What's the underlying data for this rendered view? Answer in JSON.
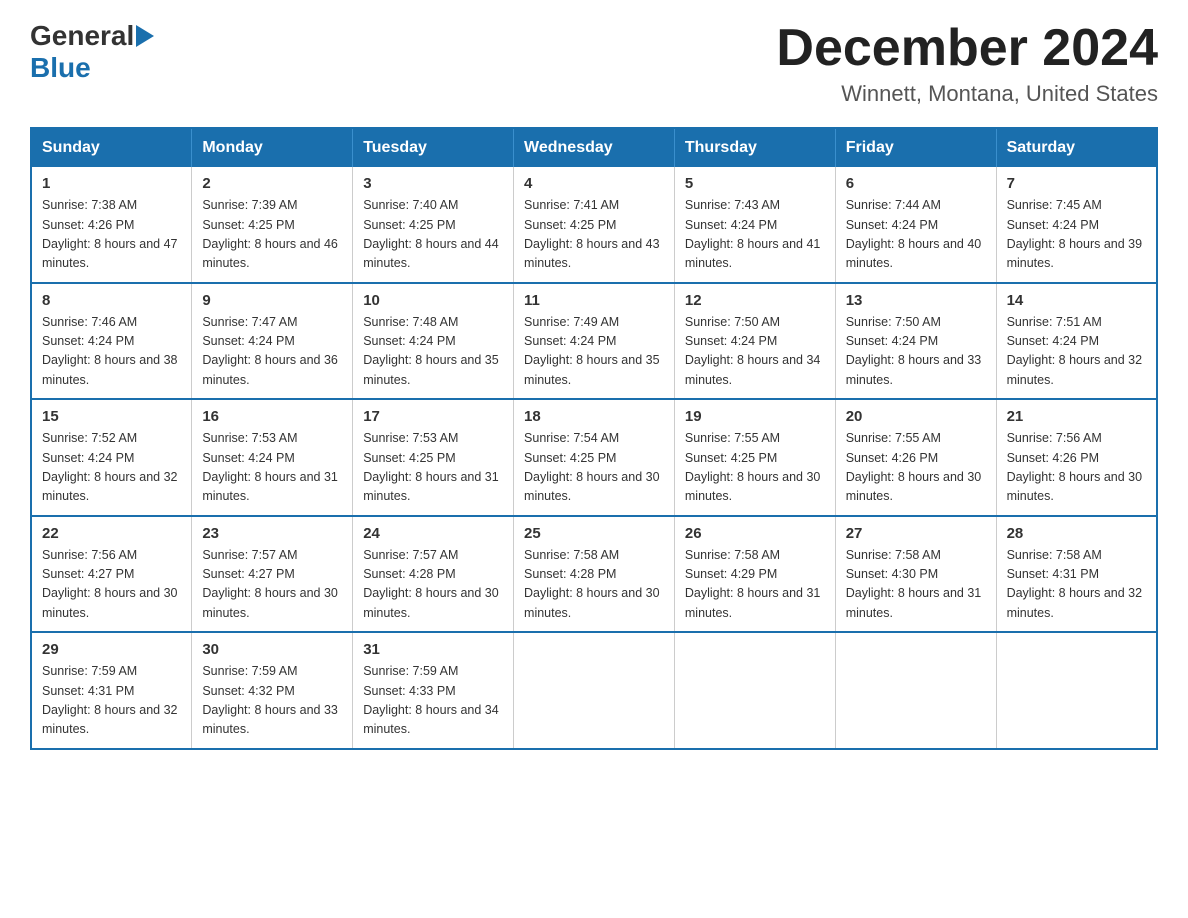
{
  "header": {
    "logo_general": "General",
    "logo_blue": "Blue",
    "title": "December 2024",
    "subtitle": "Winnett, Montana, United States"
  },
  "calendar": {
    "days_of_week": [
      "Sunday",
      "Monday",
      "Tuesday",
      "Wednesday",
      "Thursday",
      "Friday",
      "Saturday"
    ],
    "weeks": [
      [
        {
          "day": "1",
          "sunrise": "7:38 AM",
          "sunset": "4:26 PM",
          "daylight": "8 hours and 47 minutes."
        },
        {
          "day": "2",
          "sunrise": "7:39 AM",
          "sunset": "4:25 PM",
          "daylight": "8 hours and 46 minutes."
        },
        {
          "day": "3",
          "sunrise": "7:40 AM",
          "sunset": "4:25 PM",
          "daylight": "8 hours and 44 minutes."
        },
        {
          "day": "4",
          "sunrise": "7:41 AM",
          "sunset": "4:25 PM",
          "daylight": "8 hours and 43 minutes."
        },
        {
          "day": "5",
          "sunrise": "7:43 AM",
          "sunset": "4:24 PM",
          "daylight": "8 hours and 41 minutes."
        },
        {
          "day": "6",
          "sunrise": "7:44 AM",
          "sunset": "4:24 PM",
          "daylight": "8 hours and 40 minutes."
        },
        {
          "day": "7",
          "sunrise": "7:45 AM",
          "sunset": "4:24 PM",
          "daylight": "8 hours and 39 minutes."
        }
      ],
      [
        {
          "day": "8",
          "sunrise": "7:46 AM",
          "sunset": "4:24 PM",
          "daylight": "8 hours and 38 minutes."
        },
        {
          "day": "9",
          "sunrise": "7:47 AM",
          "sunset": "4:24 PM",
          "daylight": "8 hours and 36 minutes."
        },
        {
          "day": "10",
          "sunrise": "7:48 AM",
          "sunset": "4:24 PM",
          "daylight": "8 hours and 35 minutes."
        },
        {
          "day": "11",
          "sunrise": "7:49 AM",
          "sunset": "4:24 PM",
          "daylight": "8 hours and 35 minutes."
        },
        {
          "day": "12",
          "sunrise": "7:50 AM",
          "sunset": "4:24 PM",
          "daylight": "8 hours and 34 minutes."
        },
        {
          "day": "13",
          "sunrise": "7:50 AM",
          "sunset": "4:24 PM",
          "daylight": "8 hours and 33 minutes."
        },
        {
          "day": "14",
          "sunrise": "7:51 AM",
          "sunset": "4:24 PM",
          "daylight": "8 hours and 32 minutes."
        }
      ],
      [
        {
          "day": "15",
          "sunrise": "7:52 AM",
          "sunset": "4:24 PM",
          "daylight": "8 hours and 32 minutes."
        },
        {
          "day": "16",
          "sunrise": "7:53 AM",
          "sunset": "4:24 PM",
          "daylight": "8 hours and 31 minutes."
        },
        {
          "day": "17",
          "sunrise": "7:53 AM",
          "sunset": "4:25 PM",
          "daylight": "8 hours and 31 minutes."
        },
        {
          "day": "18",
          "sunrise": "7:54 AM",
          "sunset": "4:25 PM",
          "daylight": "8 hours and 30 minutes."
        },
        {
          "day": "19",
          "sunrise": "7:55 AM",
          "sunset": "4:25 PM",
          "daylight": "8 hours and 30 minutes."
        },
        {
          "day": "20",
          "sunrise": "7:55 AM",
          "sunset": "4:26 PM",
          "daylight": "8 hours and 30 minutes."
        },
        {
          "day": "21",
          "sunrise": "7:56 AM",
          "sunset": "4:26 PM",
          "daylight": "8 hours and 30 minutes."
        }
      ],
      [
        {
          "day": "22",
          "sunrise": "7:56 AM",
          "sunset": "4:27 PM",
          "daylight": "8 hours and 30 minutes."
        },
        {
          "day": "23",
          "sunrise": "7:57 AM",
          "sunset": "4:27 PM",
          "daylight": "8 hours and 30 minutes."
        },
        {
          "day": "24",
          "sunrise": "7:57 AM",
          "sunset": "4:28 PM",
          "daylight": "8 hours and 30 minutes."
        },
        {
          "day": "25",
          "sunrise": "7:58 AM",
          "sunset": "4:28 PM",
          "daylight": "8 hours and 30 minutes."
        },
        {
          "day": "26",
          "sunrise": "7:58 AM",
          "sunset": "4:29 PM",
          "daylight": "8 hours and 31 minutes."
        },
        {
          "day": "27",
          "sunrise": "7:58 AM",
          "sunset": "4:30 PM",
          "daylight": "8 hours and 31 minutes."
        },
        {
          "day": "28",
          "sunrise": "7:58 AM",
          "sunset": "4:31 PM",
          "daylight": "8 hours and 32 minutes."
        }
      ],
      [
        {
          "day": "29",
          "sunrise": "7:59 AM",
          "sunset": "4:31 PM",
          "daylight": "8 hours and 32 minutes."
        },
        {
          "day": "30",
          "sunrise": "7:59 AM",
          "sunset": "4:32 PM",
          "daylight": "8 hours and 33 minutes."
        },
        {
          "day": "31",
          "sunrise": "7:59 AM",
          "sunset": "4:33 PM",
          "daylight": "8 hours and 34 minutes."
        },
        null,
        null,
        null,
        null
      ]
    ]
  }
}
